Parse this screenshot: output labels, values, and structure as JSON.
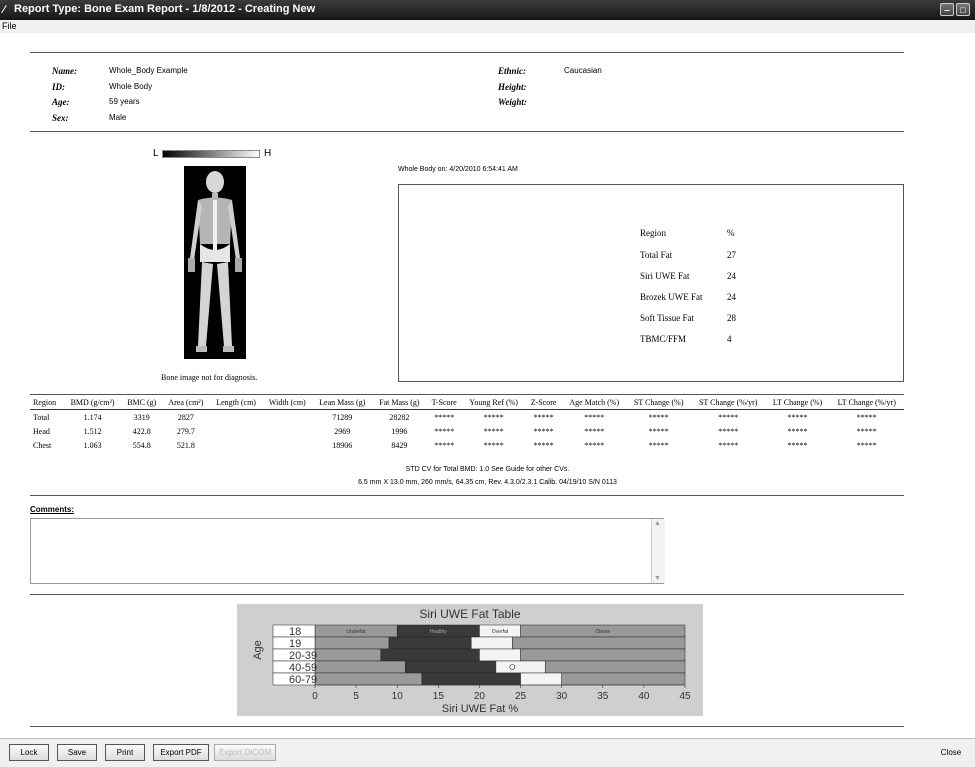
{
  "window": {
    "title": "Report Type: Bone Exam Report - 1/8/2012 - Creating New",
    "menu": [
      "File"
    ]
  },
  "patient": {
    "name_label": "Name:",
    "name": "Whole_Body Example",
    "id_label": "ID:",
    "id": "Whole Body",
    "age_label": "Age:",
    "age": "59 years",
    "sex_label": "Sex:",
    "sex": "Male",
    "ethnic_label": "Ethnic:",
    "ethnic": "Caucasian",
    "height_label": "Height:",
    "weight_label": "Weight:"
  },
  "image": {
    "scale_low": "L",
    "scale_high": "H",
    "caption": "Bone image not for diagnosis."
  },
  "scan_info": "Whole Body on: 4/20/2010 6:54:41 AM",
  "composition": {
    "header_region": "Region",
    "header_percent": "%",
    "rows": [
      {
        "label": "Total Fat",
        "value": "27"
      },
      {
        "label": "Siri UWE Fat",
        "value": "24"
      },
      {
        "label": "Brozek UWE Fat",
        "value": "24"
      },
      {
        "label": "Soft Tissue Fat",
        "value": "28"
      },
      {
        "label": "TBMC/FFM",
        "value": "4"
      }
    ]
  },
  "results_table": {
    "headers": [
      "Region",
      "BMD (g/cm²)",
      "BMC (g)",
      "Area (cm²)",
      "Length (cm)",
      "Width (cm)",
      "Lean Mass (g)",
      "Fat Mass (g)",
      "T-Score",
      "Young Ref (%)",
      "Z-Score",
      "Age Match (%)",
      "ST Change (%)",
      "ST Change (%/yr)",
      "LT Change (%)",
      "LT Change (%/yr)"
    ],
    "rows": [
      [
        "Total",
        "1.174",
        "3319",
        "2827",
        "",
        "",
        "71289",
        "28282",
        "*****",
        "*****",
        "*****",
        "*****",
        "*****",
        "*****",
        "*****",
        "*****"
      ],
      [
        "Head",
        "1.512",
        "422.8",
        "279.7",
        "",
        "",
        "2969",
        "1996",
        "*****",
        "*****",
        "*****",
        "*****",
        "*****",
        "*****",
        "*****",
        "*****"
      ],
      [
        "Chest",
        "1.063",
        "554.8",
        "521.8",
        "",
        "",
        "18906",
        "8429",
        "*****",
        "*****",
        "*****",
        "*****",
        "*****",
        "*****",
        "*****",
        "*****"
      ]
    ]
  },
  "notes": {
    "line1": "STD CV for Total BMD: 1.0 See Guide for other CVs.",
    "line2": "6.5 mm X 13.0 mm, 260 mm/s, 64.35 cm, Rev. 4.3.0/2.3.1 Calib. 04/19/10 S/N 0113"
  },
  "comments": {
    "label": "Comments:",
    "value": ""
  },
  "chart_data": {
    "type": "bar",
    "title": "Siri UWE Fat Table",
    "xlabel": "Siri UWE Fat %",
    "ylabel": "Age",
    "xlim": [
      0,
      45
    ],
    "xticks": [
      "0",
      "5",
      "10",
      "15",
      "20",
      "25",
      "30",
      "35",
      "40",
      "45"
    ],
    "categories": [
      "18",
      "19",
      "20-39",
      "40-59",
      "60-79"
    ],
    "zones": [
      "Underfat",
      "Healthy",
      "Overfat",
      "Obese"
    ],
    "zone_bounds": [
      [
        0,
        10,
        20,
        25,
        45
      ],
      [
        0,
        9,
        19,
        24,
        45
      ],
      [
        0,
        8,
        20,
        25,
        45
      ],
      [
        0,
        11,
        22,
        28,
        45
      ],
      [
        0,
        13,
        25,
        30,
        45
      ]
    ],
    "patient_value": 24,
    "patient_category": "40-59",
    "colors": {
      "Underfat": "#9a9a9a",
      "Healthy": "#3a3a3a",
      "Overfat": "#f4f4f4",
      "Obese": "#9a9a9a",
      "marker": "#ffffff"
    }
  },
  "buttons": {
    "lock": "Lock",
    "save": "Save",
    "print": "Print",
    "export_pdf": "Export PDF",
    "export_dicom": "Export DICOM",
    "close": "Close"
  }
}
